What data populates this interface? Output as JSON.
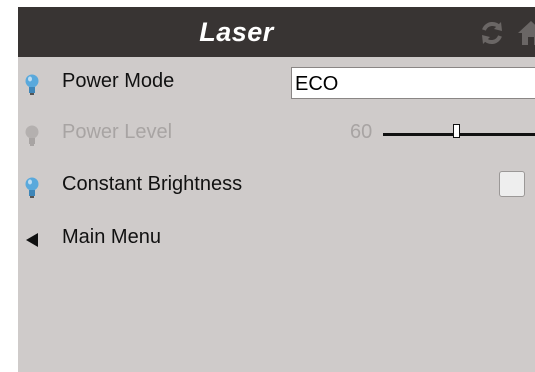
{
  "header": {
    "title": "Laser",
    "icons": [
      "refresh-icon",
      "home-icon"
    ]
  },
  "menu": {
    "power_mode": {
      "label": "Power Mode",
      "value": "ECO",
      "enabled": true
    },
    "power_level": {
      "label": "Power Level",
      "value": "60",
      "enabled": false,
      "slider_fraction": 0.46
    },
    "constant_brightness": {
      "label": "Constant Brightness",
      "checked": false,
      "enabled": true
    },
    "main_menu": {
      "label": "Main Menu"
    }
  },
  "colors": {
    "titlebar": "#383433",
    "panel": "#cfcbca",
    "bulb_active": "#5aa9dc",
    "bulb_disabled": "#b4b0af"
  }
}
